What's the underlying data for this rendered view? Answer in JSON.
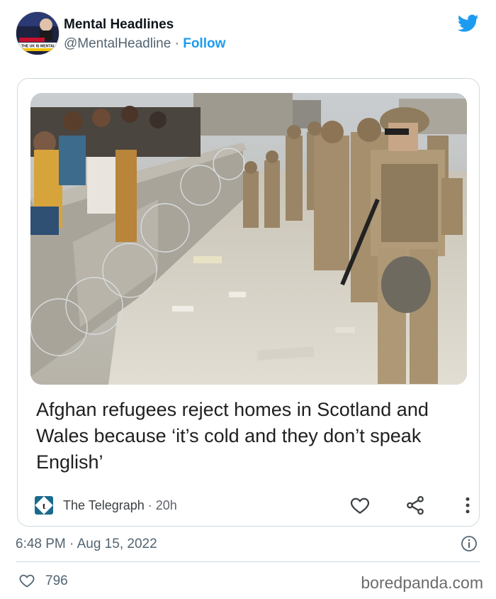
{
  "tweet": {
    "display_name": "Mental Headlines",
    "handle": "@MentalHeadline",
    "separator": " · ",
    "follow_label": "Follow",
    "avatar_caption": "THE UK IS MENTAL",
    "timestamp": "6:48 PM · Aug 15, 2022",
    "like_count": "796"
  },
  "article": {
    "headline": "Afghan refugees reject homes in Scotland and Wales because ‘it’s cold and they don’t speak English’",
    "source_name": "The Telegraph",
    "source_time": " · 20h"
  },
  "footer": {
    "watermark": "boredpanda.com"
  },
  "colors": {
    "twitter_blue": "#1d9bf0",
    "text_secondary": "#536471",
    "border": "#cfd9de"
  },
  "icons": [
    "twitter-bird-icon",
    "telegraph-logo-icon",
    "heart-icon",
    "share-icon",
    "more-vertical-icon",
    "info-icon",
    "like-heart-icon"
  ]
}
